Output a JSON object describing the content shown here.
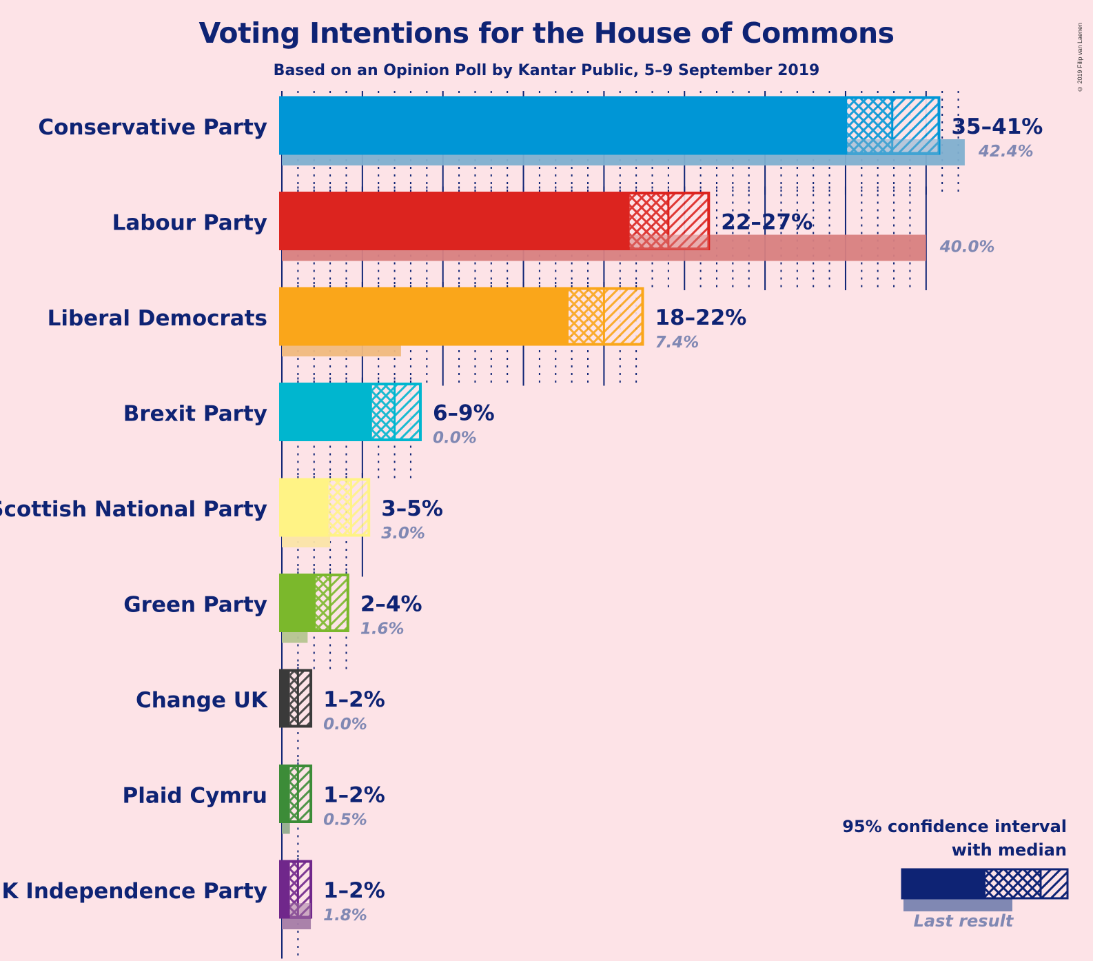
{
  "header": {
    "title": "Voting Intentions for the House of Commons",
    "subtitle": "Based on an Opinion Poll by Kantar Public, 5–9 September 2019",
    "copyright": "© 2019 Filip van Laenen"
  },
  "legend": {
    "title_line1": "95% confidence interval",
    "title_line2": "with median",
    "last_result_label": "Last result",
    "color": "#0e2374",
    "last_color": "#8088b3"
  },
  "chart_data": {
    "type": "bar",
    "orientation": "horizontal",
    "title": "Voting Intentions for the House of Commons",
    "subtitle": "Based on an Opinion Poll by Kantar Public, 5–9 September 2019",
    "xlabel": "",
    "ylabel": "",
    "xlim": [
      0,
      45
    ],
    "grid": {
      "major_every_pct": 5,
      "minor_every_pct": 1,
      "minor_style": "dotted"
    },
    "legend_position": "bottom-right",
    "categories": [
      "Conservative Party",
      "Labour Party",
      "Liberal Democrats",
      "Brexit Party",
      "Scottish National Party",
      "Green Party",
      "Change UK",
      "Plaid Cymru",
      "UK Independence Party"
    ],
    "series": [
      {
        "name": "95% CI low",
        "values": [
          35.1,
          21.6,
          17.8,
          5.6,
          2.9,
          2.1,
          0.5,
          0.5,
          0.5
        ]
      },
      {
        "name": "Median",
        "values": [
          37.9,
          24.0,
          20.0,
          7.0,
          4.3,
          3.0,
          1.0,
          1.0,
          1.0
        ]
      },
      {
        "name": "95% CI high",
        "values": [
          40.8,
          26.5,
          22.4,
          8.6,
          5.4,
          4.1,
          1.8,
          1.8,
          1.8
        ]
      },
      {
        "name": "Last result",
        "values": [
          42.4,
          40.0,
          7.4,
          0.0,
          3.0,
          1.6,
          0.0,
          0.5,
          1.8
        ]
      }
    ],
    "range_labels": [
      "35–41%",
      "22–27%",
      "18–22%",
      "6–9%",
      "3–5%",
      "2–4%",
      "1–2%",
      "1–2%",
      "1–2%"
    ],
    "last_labels": [
      "42.4%",
      "40.0%",
      "7.4%",
      "0.0%",
      "3.0%",
      "1.6%",
      "0.0%",
      "0.5%",
      "1.8%"
    ],
    "colors": [
      "#0096d6",
      "#dc241f",
      "#faa61a",
      "#00b6cf",
      "#fff385",
      "#7bb82c",
      "#3a3a3a",
      "#3c8c38",
      "#70278b"
    ],
    "last_colors": [
      "#80afcf",
      "#d88080",
      "#f0b97e",
      "#80c6d4",
      "#fbe4a8",
      "#b5c490",
      "#9a9a9a",
      "#93ad8f",
      "#a57ca6"
    ]
  }
}
